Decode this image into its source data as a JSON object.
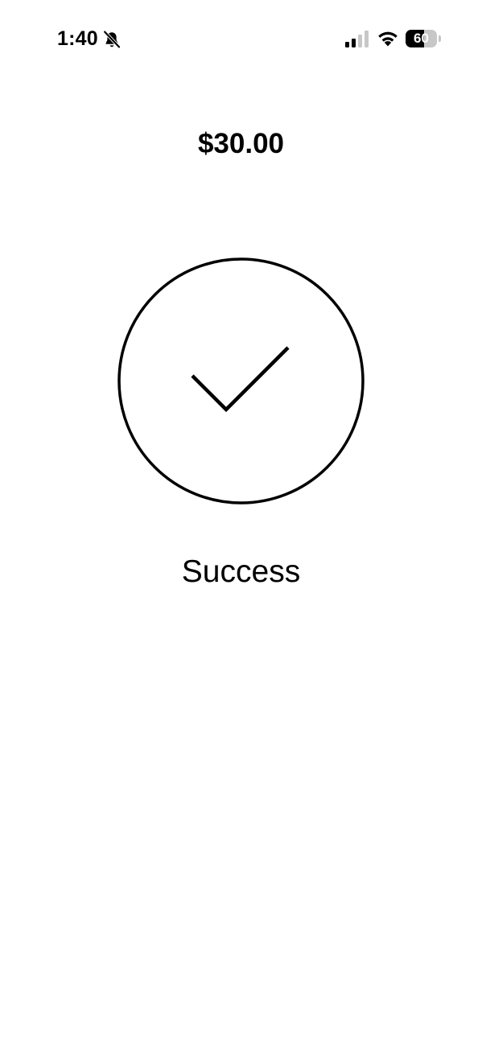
{
  "status_bar": {
    "time": "1:40",
    "silent_mode_icon": "bell-slash-icon",
    "signal_icon": "cellular-signal-icon",
    "signal_bars_active": 2,
    "signal_bars_total": 4,
    "wifi_icon": "wifi-icon",
    "battery_level": "60",
    "battery_fraction": 0.6
  },
  "payment": {
    "amount": "$30.00",
    "status_label": "Success",
    "status_icon": "checkmark-circle-icon"
  },
  "colors": {
    "background": "#ffffff",
    "foreground": "#000000",
    "battery_empty": "#c7c7c7"
  }
}
